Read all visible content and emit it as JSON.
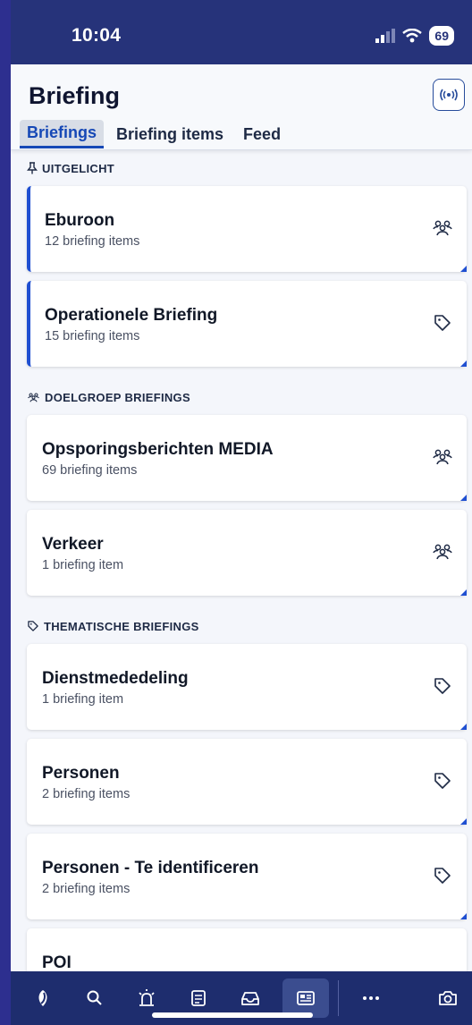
{
  "status_bar": {
    "time": "10:04",
    "battery": "69"
  },
  "header": {
    "title": "Briefing",
    "broadcast_icon": "broadcast-icon"
  },
  "tabs": [
    {
      "label": "Briefings",
      "active": true
    },
    {
      "label": "Briefing items",
      "active": false
    },
    {
      "label": "Feed",
      "active": false
    }
  ],
  "sections": [
    {
      "title": "UITGELICHT",
      "icon": "pin-icon",
      "cards": [
        {
          "title": "Eburoon",
          "subtitle": "12 briefing items",
          "icon": "group-icon",
          "highlighted": true
        },
        {
          "title": "Operationele Briefing",
          "subtitle": "15 briefing items",
          "icon": "tag-icon",
          "highlighted": true
        }
      ]
    },
    {
      "title": "DOELGROEP BRIEFINGS",
      "icon": "group-icon",
      "cards": [
        {
          "title": "Opsporingsberichten MEDIA",
          "subtitle": "69 briefing items",
          "icon": "group-icon",
          "highlighted": false
        },
        {
          "title": "Verkeer",
          "subtitle": "1 briefing item",
          "icon": "group-icon",
          "highlighted": false
        }
      ]
    },
    {
      "title": "THEMATISCHE BRIEFINGS",
      "icon": "tag-icon",
      "cards": [
        {
          "title": "Dienstmededeling",
          "subtitle": "1 briefing item",
          "icon": "tag-icon",
          "highlighted": false
        },
        {
          "title": "Personen",
          "subtitle": "2 briefing items",
          "icon": "tag-icon",
          "highlighted": false
        },
        {
          "title": "Personen - Te identificeren",
          "subtitle": "2 briefing items",
          "icon": "tag-icon",
          "highlighted": false
        },
        {
          "title": "POI",
          "subtitle": "",
          "icon": "tag-icon",
          "highlighted": false
        }
      ]
    }
  ],
  "bottom_nav": [
    {
      "name": "app-logo-icon",
      "active": false
    },
    {
      "name": "search-icon",
      "active": false
    },
    {
      "name": "siren-icon",
      "active": false
    },
    {
      "name": "notes-icon",
      "active": false
    },
    {
      "name": "inbox-icon",
      "active": false
    },
    {
      "name": "briefing-icon",
      "active": true
    },
    {
      "name": "more-icon",
      "active": false
    },
    {
      "name": "camera-icon",
      "active": false
    }
  ],
  "colors": {
    "accent": "#1f4fd1",
    "navbar": "#1e2d6e",
    "statusbar": "#26337a"
  }
}
